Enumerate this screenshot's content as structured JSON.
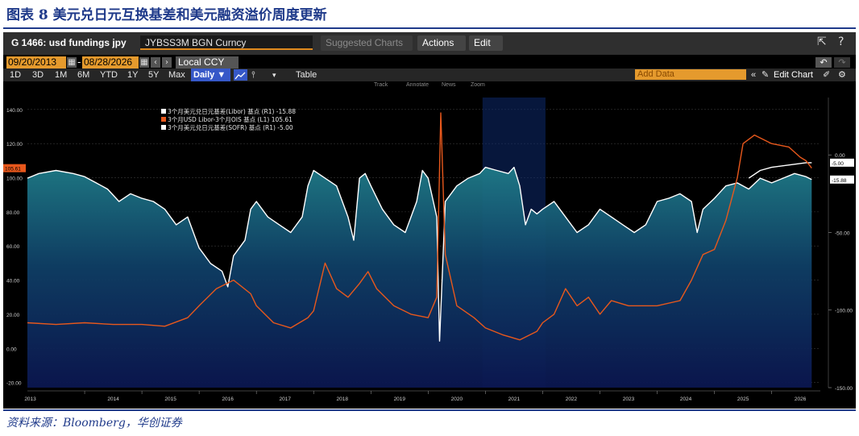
{
  "report": {
    "title": "图表 8 美元兑日元互换基差和美元融资溢价周度更新",
    "source": "资料来源：Bloomberg，华创证券"
  },
  "toolbar": {
    "security": "G 1466: usd fundings jpy",
    "ticker": "JYBSS3M BGN Curncy",
    "suggested": "Suggested Charts ⌄",
    "actions": "Actions ⌄",
    "edit": "Edit ⌄",
    "start_date": "09/20/2013",
    "end_date": "08/28/2026",
    "currency": "Local CCY",
    "ranges": [
      "1D",
      "3D",
      "1M",
      "6M",
      "YTD",
      "1Y",
      "5Y",
      "Max"
    ],
    "frequency": "Daily ▼",
    "table": "Table",
    "add_data_placeholder": "Add Data",
    "edit_chart": "Edit Chart",
    "sub_tools": [
      "Track",
      "Annotate",
      "News",
      "Zoom"
    ]
  },
  "chart_data": {
    "type": "area",
    "title": "",
    "xlabel": "",
    "x_ticks": [
      "2013",
      "2014",
      "2015",
      "2016",
      "2017",
      "2018",
      "2019",
      "2020",
      "2021",
      "2022",
      "2023",
      "2024",
      "2025",
      "2026"
    ],
    "left_axis": {
      "ticks": [
        "140.00",
        "120.00",
        "100.00",
        "80.00",
        "60.00",
        "40.00",
        "20.00",
        "0.00",
        "-20.00"
      ],
      "ylim": [
        -23,
        147
      ],
      "current_label": "105.61"
    },
    "right_axis": {
      "ticks": [
        "0.00",
        "-50.00",
        "-100.00",
        "-150.00"
      ],
      "ylim": [
        -150,
        37
      ],
      "current_labels": [
        "-5.00",
        "-15.88"
      ]
    },
    "legend": [
      {
        "label": "3个月美元兑日元基差(Libor) 基点 (R1) -15.88",
        "color": "#ffffff"
      },
      {
        "label": "3个月USD Libor-3个月OIS 基点 (L1)     105.61",
        "color": "#e8581c"
      },
      {
        "label": "3个月美元兑日元基差(SOFR) 基点 (R1) -5.00",
        "color": "#ffffff"
      }
    ],
    "series": [
      {
        "name": "3个月美元兑日元基差(Libor) 基点 (R1)",
        "axis": "right",
        "color": "#ffffff",
        "points": [
          [
            2013.0,
            -15
          ],
          [
            2013.2,
            -12
          ],
          [
            2013.5,
            -10
          ],
          [
            2013.8,
            -12
          ],
          [
            2014.0,
            -14
          ],
          [
            2014.2,
            -18
          ],
          [
            2014.4,
            -22
          ],
          [
            2014.6,
            -30
          ],
          [
            2014.8,
            -25
          ],
          [
            2015.0,
            -28
          ],
          [
            2015.2,
            -30
          ],
          [
            2015.4,
            -35
          ],
          [
            2015.6,
            -45
          ],
          [
            2015.8,
            -40
          ],
          [
            2016.0,
            -60
          ],
          [
            2016.2,
            -70
          ],
          [
            2016.4,
            -75
          ],
          [
            2016.5,
            -85
          ],
          [
            2016.6,
            -65
          ],
          [
            2016.8,
            -55
          ],
          [
            2016.9,
            -35
          ],
          [
            2017.0,
            -30
          ],
          [
            2017.2,
            -40
          ],
          [
            2017.4,
            -45
          ],
          [
            2017.6,
            -50
          ],
          [
            2017.8,
            -40
          ],
          [
            2017.9,
            -20
          ],
          [
            2018.0,
            -10
          ],
          [
            2018.2,
            -15
          ],
          [
            2018.4,
            -20
          ],
          [
            2018.6,
            -40
          ],
          [
            2018.7,
            -55
          ],
          [
            2018.8,
            -15
          ],
          [
            2018.9,
            -12
          ],
          [
            2019.0,
            -20
          ],
          [
            2019.2,
            -35
          ],
          [
            2019.4,
            -45
          ],
          [
            2019.6,
            -50
          ],
          [
            2019.8,
            -30
          ],
          [
            2019.9,
            -10
          ],
          [
            2020.0,
            -15
          ],
          [
            2020.15,
            -40
          ],
          [
            2020.2,
            -120
          ],
          [
            2020.3,
            -30
          ],
          [
            2020.5,
            -20
          ],
          [
            2020.7,
            -15
          ],
          [
            2020.9,
            -12
          ],
          [
            2021.0,
            -8
          ],
          [
            2021.2,
            -10
          ],
          [
            2021.4,
            -12
          ],
          [
            2021.5,
            -8
          ],
          [
            2021.6,
            -20
          ],
          [
            2021.7,
            -45
          ],
          [
            2021.8,
            -35
          ],
          [
            2021.9,
            -38
          ],
          [
            2022.0,
            -35
          ],
          [
            2022.2,
            -30
          ],
          [
            2022.4,
            -40
          ],
          [
            2022.6,
            -50
          ],
          [
            2022.8,
            -45
          ],
          [
            2023.0,
            -35
          ],
          [
            2023.2,
            -40
          ],
          [
            2023.4,
            -45
          ],
          [
            2023.6,
            -50
          ],
          [
            2023.8,
            -45
          ],
          [
            2024.0,
            -30
          ],
          [
            2024.2,
            -28
          ],
          [
            2024.4,
            -25
          ],
          [
            2024.6,
            -30
          ],
          [
            2024.7,
            -50
          ],
          [
            2024.8,
            -35
          ],
          [
            2025.0,
            -28
          ],
          [
            2025.2,
            -20
          ],
          [
            2025.4,
            -18
          ],
          [
            2025.6,
            -22
          ],
          [
            2025.8,
            -15
          ],
          [
            2026.0,
            -18
          ],
          [
            2026.2,
            -15
          ],
          [
            2026.4,
            -12
          ],
          [
            2026.6,
            -14
          ],
          [
            2026.7,
            -15.88
          ]
        ]
      },
      {
        "name": "3个月美元兑日元基差(SOFR) 基点 (R1)",
        "axis": "right",
        "color": "#ffffff",
        "points": [
          [
            2025.6,
            -15
          ],
          [
            2025.8,
            -10
          ],
          [
            2026.0,
            -8
          ],
          [
            2026.2,
            -7
          ],
          [
            2026.4,
            -6
          ],
          [
            2026.6,
            -5
          ],
          [
            2026.7,
            -5
          ]
        ]
      },
      {
        "name": "3个月USD Libor-3个月OIS 基点 (L1)",
        "axis": "left",
        "color": "#e8581c",
        "points": [
          [
            2013.0,
            15
          ],
          [
            2013.5,
            14
          ],
          [
            2014.0,
            15
          ],
          [
            2014.5,
            14
          ],
          [
            2015.0,
            14
          ],
          [
            2015.4,
            13
          ],
          [
            2015.8,
            18
          ],
          [
            2016.0,
            25
          ],
          [
            2016.3,
            35
          ],
          [
            2016.6,
            40
          ],
          [
            2016.9,
            32
          ],
          [
            2017.0,
            25
          ],
          [
            2017.3,
            15
          ],
          [
            2017.6,
            12
          ],
          [
            2017.9,
            18
          ],
          [
            2018.0,
            22
          ],
          [
            2018.2,
            50
          ],
          [
            2018.4,
            35
          ],
          [
            2018.6,
            30
          ],
          [
            2018.8,
            38
          ],
          [
            2018.95,
            45
          ],
          [
            2019.1,
            35
          ],
          [
            2019.4,
            25
          ],
          [
            2019.7,
            20
          ],
          [
            2020.0,
            18
          ],
          [
            2020.15,
            30
          ],
          [
            2020.22,
            138
          ],
          [
            2020.3,
            55
          ],
          [
            2020.5,
            25
          ],
          [
            2020.8,
            18
          ],
          [
            2021.0,
            12
          ],
          [
            2021.3,
            8
          ],
          [
            2021.6,
            5
          ],
          [
            2021.9,
            10
          ],
          [
            2022.0,
            15
          ],
          [
            2022.2,
            20
          ],
          [
            2022.4,
            35
          ],
          [
            2022.6,
            25
          ],
          [
            2022.8,
            30
          ],
          [
            2023.0,
            20
          ],
          [
            2023.2,
            28
          ],
          [
            2023.5,
            25
          ],
          [
            2023.8,
            25
          ],
          [
            2024.0,
            25
          ],
          [
            2024.4,
            28
          ],
          [
            2024.6,
            40
          ],
          [
            2024.8,
            55
          ],
          [
            2025.0,
            58
          ],
          [
            2025.2,
            75
          ],
          [
            2025.4,
            100
          ],
          [
            2025.5,
            120
          ],
          [
            2025.7,
            125
          ],
          [
            2026.0,
            120
          ],
          [
            2026.3,
            118
          ],
          [
            2026.5,
            112
          ],
          [
            2026.6,
            110
          ],
          [
            2026.7,
            105.61
          ]
        ]
      }
    ]
  }
}
